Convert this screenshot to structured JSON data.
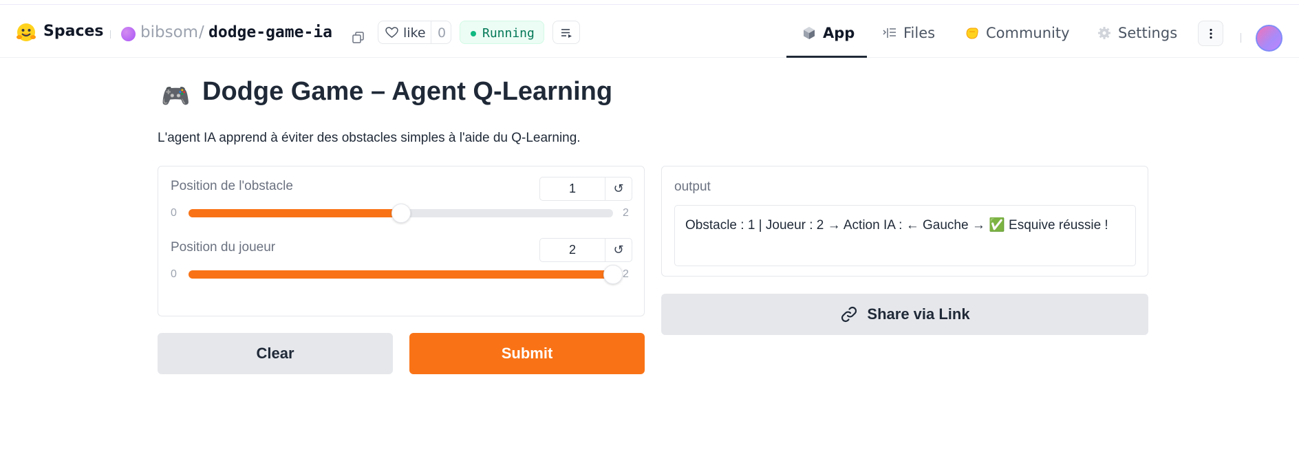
{
  "header": {
    "brand": "Spaces",
    "owner": "bibsom",
    "separator": "/",
    "repo": "dodge-game-ia",
    "like_label": "like",
    "like_count": "0",
    "status": "Running",
    "nav": {
      "app": "App",
      "files": "Files",
      "community": "Community",
      "settings": "Settings"
    }
  },
  "app": {
    "title_emoji": "🎮",
    "title": "Dodge Game – Agent Q-Learning",
    "description": "L'agent IA apprend à éviter des obstacles simples à l'aide du Q-Learning.",
    "sliders": [
      {
        "label": "Position de l'obstacle",
        "value": "1",
        "min": "0",
        "max": "2",
        "fraction": 0.5
      },
      {
        "label": "Position du joueur",
        "value": "2",
        "min": "0",
        "max": "2",
        "fraction": 1.0
      }
    ],
    "reset_symbol": "↺",
    "output_label": "output",
    "output_text": "Obstacle : 1 | Joueur : 2 → Action IA : ← Gauche → ✅ Esquive réussie !",
    "buttons": {
      "clear": "Clear",
      "submit": "Submit",
      "share": "Share via Link"
    }
  },
  "colors": {
    "accent": "#f97316",
    "status_green": "#10b981"
  }
}
